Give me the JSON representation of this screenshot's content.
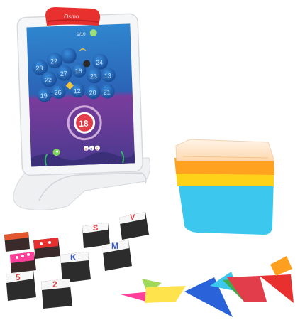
{
  "device": {
    "reflector_brand": "Osmo",
    "screen_score": "2/10",
    "bubble_numbers": [
      "23",
      "22",
      "24",
      "22",
      "27",
      "16",
      "23",
      "13",
      "19",
      "26",
      "12",
      "20",
      "21"
    ],
    "target_number": "18",
    "tiny_numbers": [
      "6",
      "8",
      "5"
    ]
  },
  "tiles": {
    "letters": [
      "V",
      "S",
      "K",
      "M",
      "5",
      "2"
    ]
  },
  "colors": {
    "reflector_red": "#e8312f",
    "screen_top": "#1f6fb8",
    "screen_bottom": "#5a3f9a",
    "tray_orange": "#ffa21f",
    "tray_yellow": "#ffd21a",
    "tray_blue": "#3cc7ef"
  }
}
